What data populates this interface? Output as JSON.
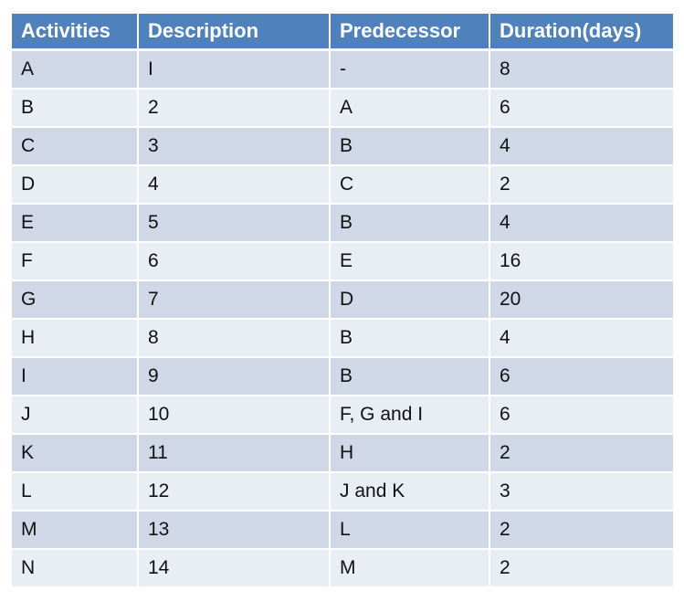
{
  "colors": {
    "header_bg": "#4F81BD",
    "row_odd_bg": "#D0D8E8",
    "row_even_bg": "#E9EDF4",
    "header_text": "#FFFFFF"
  },
  "table": {
    "headers": [
      "Activities",
      "Description",
      "Predecessor",
      "Duration(days)"
    ],
    "rows": [
      [
        "A",
        "I",
        "-",
        "8"
      ],
      [
        "B",
        "2",
        "A",
        "6"
      ],
      [
        "C",
        "3",
        "B",
        "4"
      ],
      [
        "D",
        "4",
        "C",
        "2"
      ],
      [
        "E",
        "5",
        "B",
        "4"
      ],
      [
        "F",
        "6",
        "E",
        "16"
      ],
      [
        "G",
        "7",
        "D",
        "20"
      ],
      [
        "H",
        "8",
        "B",
        "4"
      ],
      [
        "I",
        "9",
        "B",
        "6"
      ],
      [
        "J",
        "10",
        "F, G and I",
        "6"
      ],
      [
        "K",
        "11",
        "H",
        "2"
      ],
      [
        "L",
        "12",
        "J and K",
        "3"
      ],
      [
        "M",
        "13",
        "L",
        "2"
      ],
      [
        "N",
        "14",
        "M",
        "2"
      ]
    ]
  }
}
